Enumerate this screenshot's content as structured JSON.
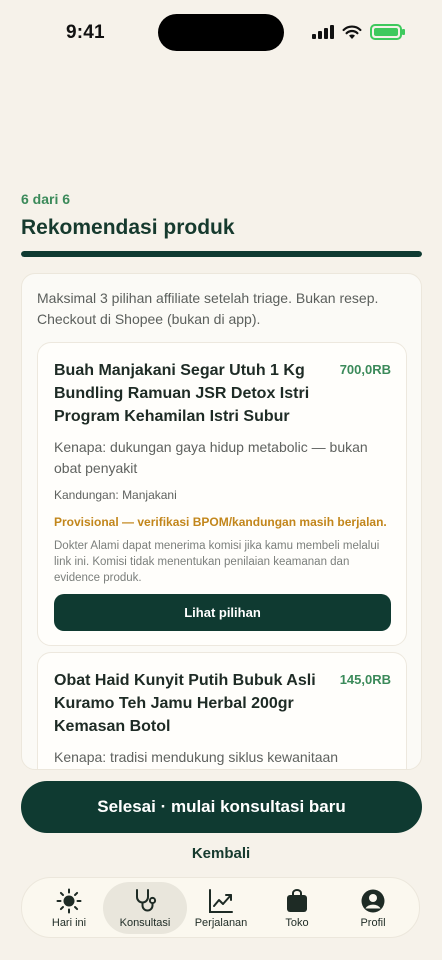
{
  "status_bar": {
    "time": "9:41"
  },
  "header": {
    "step": "6 dari 6",
    "title": "Rekomendasi produk",
    "progress_fraction": 1.0
  },
  "intro": "Maksimal 3 pilihan affiliate setelah triage. Bukan resep. Checkout di Shopee (bukan di app).",
  "products": [
    {
      "title": "Buah Manjakani Segar Utuh 1 Kg Bundling Ramuan JSR Detox Istri Program Kehamilan Istri Subur",
      "price": "700,0RB",
      "reason": "Kenapa: dukungan gaya hidup metabolic — bukan obat penyakit",
      "ingredients": "Kandungan: Manjakani",
      "warning": "Provisional — verifikasi BPOM/kandungan masih berjalan.",
      "disclosure": "Dokter Alami dapat menerima komisi jika kamu membeli melalui link ini. Komisi tidak menentukan penilaian keamanan dan evidence produk.",
      "button": "Lihat pilihan"
    },
    {
      "title": "Obat Haid Kunyit Putih Bubuk Asli Kuramo Teh Jamu Herbal 200gr Kemasan Botol",
      "price": "145,0RB",
      "reason": "Kenapa: tradisi mendukung siklus kewanitaan"
    }
  ],
  "actions": {
    "finish": "Selesai · mulai konsultasi baru",
    "back": "Kembali"
  },
  "tabs": [
    {
      "label": "Hari ini",
      "icon": "sun-icon"
    },
    {
      "label": "Konsultasi",
      "icon": "stethoscope-icon",
      "active": true
    },
    {
      "label": "Perjalanan",
      "icon": "chart-icon"
    },
    {
      "label": "Toko",
      "icon": "bag-icon"
    },
    {
      "label": "Profil",
      "icon": "profile-icon"
    }
  ],
  "colors": {
    "primary": "#0f3a31",
    "accent_green": "#3b8a5a",
    "warning": "#c2861b",
    "background": "#f6f2ea"
  }
}
